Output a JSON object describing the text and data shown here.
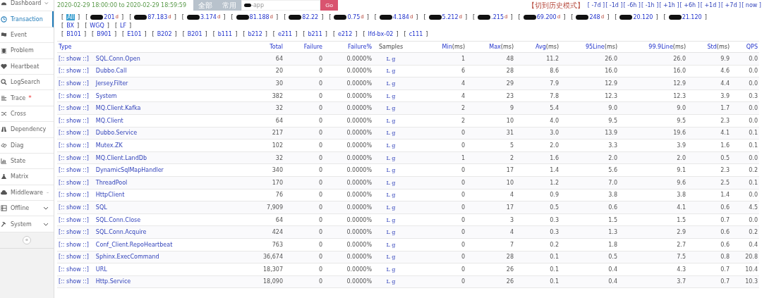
{
  "sidebar": {
    "items": [
      {
        "label": "Dashboard",
        "expandable": true,
        "selected": false
      },
      {
        "label": "Transaction",
        "expandable": false,
        "selected": true
      },
      {
        "label": "Event",
        "expandable": false,
        "selected": false
      },
      {
        "label": "Problem",
        "expandable": false,
        "selected": false
      },
      {
        "label": "Heartbeat",
        "expandable": false,
        "selected": false
      },
      {
        "label": "LogSearch",
        "expandable": false,
        "selected": false
      },
      {
        "label": "Trace",
        "expandable": false,
        "selected": false,
        "badge": "*"
      },
      {
        "label": "Cross",
        "expandable": false,
        "selected": false
      },
      {
        "label": "Dependency",
        "expandable": false,
        "selected": false
      },
      {
        "label": "Diag",
        "expandable": false,
        "selected": false
      },
      {
        "label": "State",
        "expandable": false,
        "selected": false
      },
      {
        "label": "Matrix",
        "expandable": false,
        "selected": false
      },
      {
        "label": "Middleware",
        "expandable": true,
        "selected": false
      },
      {
        "label": "Offline",
        "expandable": true,
        "selected": false
      },
      {
        "label": "System",
        "expandable": true,
        "selected": false
      }
    ],
    "collapse": "«"
  },
  "toolbar": {
    "range": "2020-02-29 18:00:00 to 2020-02-29 18:59:59",
    "buttons": [
      "全部",
      "常用"
    ],
    "domain": "-app",
    "go": "Go",
    "history": "【切到历史模式】",
    "steps": [
      "[ -7d ]",
      "[ -1d ]",
      "[ -6h ]",
      "[ -1h ]",
      "[ +1h ]",
      "[ +6h ]",
      "[ +1d ]",
      "[ +7d ]",
      "[ now ]"
    ]
  },
  "ips": [
    {
      "open": "[",
      "text": "All",
      "close": "]",
      "selected": true
    },
    {
      "open": "[",
      "text": "201",
      "flag": "d",
      "close": "]",
      "redacted": true,
      "selected": false
    },
    {
      "open": "[",
      "text": "87.183",
      "flag": "d",
      "close": "]",
      "redacted": true,
      "selected": false
    },
    {
      "open": "[",
      "text": "3.174",
      "flag": "d",
      "close": "]",
      "redacted": true,
      "selected": false
    },
    {
      "open": "[",
      "text": "81.188",
      "flag": "d",
      "close": "]",
      "redacted": true,
      "selected": false
    },
    {
      "open": "[",
      "text": "82.22",
      "close": "]",
      "redacted": true,
      "selected": false
    },
    {
      "open": "[",
      "text": "0.75",
      "flag": "d",
      "close": "]",
      "redacted": true,
      "selected": false
    },
    {
      "open": "[",
      "text": "4.184",
      "flag": "d",
      "close": "]",
      "redacted": true,
      "selected": false
    },
    {
      "open": "[",
      "text": "5.212",
      "flag": "d",
      "close": "]",
      "redacted": true,
      "selected": false
    },
    {
      "open": "[",
      "text": ".215",
      "flag": "d",
      "close": "]",
      "redacted": true,
      "selected": false
    },
    {
      "open": "[",
      "text": "69.200",
      "flag": "d",
      "close": "]",
      "redacted": true,
      "selected": false
    },
    {
      "open": "[",
      "text": "248",
      "flag": "d",
      "close": "]",
      "redacted": true,
      "selected": false
    },
    {
      "open": "[",
      "text": "20.120",
      "close": "]",
      "redacted": true,
      "selected": false
    },
    {
      "open": "[",
      "text": "21.120",
      "close": "]",
      "redacted": true,
      "selected": false
    }
  ],
  "groups": [
    {
      "open": "[",
      "text": "BX",
      "close": "]"
    },
    {
      "open": "[",
      "text": "WGQ",
      "close": "]"
    },
    {
      "open": "[",
      "text": "LF",
      "close": "]"
    }
  ],
  "machines": [
    {
      "open": "[",
      "text": "B101",
      "close": "]"
    },
    {
      "open": "[",
      "text": "B901",
      "close": "]"
    },
    {
      "open": "[",
      "text": "E101",
      "close": "]"
    },
    {
      "open": "[",
      "text": "B202",
      "close": "]"
    },
    {
      "open": "[",
      "text": "B201",
      "close": "]"
    },
    {
      "open": "[",
      "text": "b111",
      "close": "]"
    },
    {
      "open": "[",
      "text": "b212",
      "close": "]"
    },
    {
      "open": "[",
      "text": "e211",
      "close": "]"
    },
    {
      "open": "[",
      "text": "b211",
      "close": "]"
    },
    {
      "open": "[",
      "text": "e212",
      "close": "]"
    },
    {
      "open": "[",
      "text": "lfd-bx-02",
      "close": "]"
    },
    {
      "open": "[",
      "text": "c111",
      "close": "]"
    }
  ],
  "table": {
    "columns": [
      {
        "label": "Type",
        "kind": "link"
      },
      {
        "label": "Total",
        "kind": "link"
      },
      {
        "label": "Failure",
        "kind": "link"
      },
      {
        "label": "Failure%",
        "kind": "link"
      },
      {
        "label": "Samples",
        "kind": "plain"
      },
      {
        "label": "Min",
        "unit": "(ms)",
        "kind": "link"
      },
      {
        "label": "Max",
        "unit": "(ms)",
        "kind": "link"
      },
      {
        "label": "Avg",
        "unit": "(ms)",
        "kind": "link"
      },
      {
        "label": "95Line",
        "unit": "(ms)",
        "kind": "link"
      },
      {
        "label": "99.9Line",
        "unit": "(ms)",
        "kind": "link"
      },
      {
        "label": "Std",
        "unit": "(ms)",
        "kind": "link"
      },
      {
        "label": "QPS",
        "kind": "link"
      }
    ],
    "rows": [
      {
        "show": "[:: show ::]",
        "type": "SQL.Conn.Open",
        "total": "64",
        "failure": "0",
        "failure_pct": "0.0000%",
        "samples": "L g",
        "min": "1",
        "max": "48",
        "avg": "11.2",
        "p95": "26.0",
        "p999": "26.0",
        "std": "9.9",
        "qps": "0.0"
      },
      {
        "show": "[:: show ::]",
        "type": "Dubbo.Call",
        "total": "20",
        "failure": "0",
        "failure_pct": "0.0000%",
        "samples": "L g",
        "min": "6",
        "max": "28",
        "avg": "8.6",
        "p95": "16.0",
        "p999": "16.0",
        "std": "4.6",
        "qps": "0.0"
      },
      {
        "show": "[:: show ::]",
        "type": "Jersey.Filter",
        "total": "30",
        "failure": "0",
        "failure_pct": "0.0000%",
        "samples": "L g",
        "min": "4",
        "max": "29",
        "avg": "7.9",
        "p95": "12.9",
        "p999": "12.9",
        "std": "4.4",
        "qps": "0.0"
      },
      {
        "show": "[:: show ::]",
        "type": "System",
        "total": "382",
        "failure": "0",
        "failure_pct": "0.0000%",
        "samples": "L g",
        "min": "4",
        "max": "23",
        "avg": "7.8",
        "p95": "12.3",
        "p999": "12.3",
        "std": "3.9",
        "qps": "0.3"
      },
      {
        "show": "[:: show ::]",
        "type": "MQ.Client.Kafka",
        "total": "32",
        "failure": "0",
        "failure_pct": "0.0000%",
        "samples": "L g",
        "min": "2",
        "max": "9",
        "avg": "5.4",
        "p95": "9.0",
        "p999": "9.0",
        "std": "1.7",
        "qps": "0.0"
      },
      {
        "show": "[:: show ::]",
        "type": "MQ.Client",
        "total": "64",
        "failure": "0",
        "failure_pct": "0.0000%",
        "samples": "L g",
        "min": "2",
        "max": "10",
        "avg": "4.0",
        "p95": "9.5",
        "p999": "9.5",
        "std": "2.3",
        "qps": "0.0"
      },
      {
        "show": "[:: show ::]",
        "type": "Dubbo.Service",
        "total": "217",
        "failure": "0",
        "failure_pct": "0.0000%",
        "samples": "L g",
        "min": "0",
        "max": "31",
        "avg": "3.0",
        "p95": "13.9",
        "p999": "19.6",
        "std": "4.1",
        "qps": "0.1"
      },
      {
        "show": "[:: show ::]",
        "type": "Mutex.ZK",
        "total": "102",
        "failure": "0",
        "failure_pct": "0.0000%",
        "samples": "L g",
        "min": "0",
        "max": "5",
        "avg": "2.0",
        "p95": "3.3",
        "p999": "3.9",
        "std": "1.6",
        "qps": "0.1"
      },
      {
        "show": "[:: show ::]",
        "type": "MQ.Client.LandDb",
        "total": "32",
        "failure": "0",
        "failure_pct": "0.0000%",
        "samples": "L g",
        "min": "1",
        "max": "2",
        "avg": "1.6",
        "p95": "2.0",
        "p999": "2.0",
        "std": "0.5",
        "qps": "0.0"
      },
      {
        "show": "[:: show ::]",
        "type": "DynamicSqlMapHandler",
        "total": "340",
        "failure": "0",
        "failure_pct": "0.0000%",
        "samples": "L g",
        "min": "0",
        "max": "17",
        "avg": "1.4",
        "p95": "5.6",
        "p999": "9.1",
        "std": "2.3",
        "qps": "0.2"
      },
      {
        "show": "[:: show ::]",
        "type": "ThreadPool",
        "total": "170",
        "failure": "0",
        "failure_pct": "0.0000%",
        "samples": "L g",
        "min": "0",
        "max": "10",
        "avg": "1.2",
        "p95": "7.0",
        "p999": "9.6",
        "std": "2.5",
        "qps": "0.1"
      },
      {
        "show": "[:: show ::]",
        "type": "HttpClient",
        "total": "76",
        "failure": "0",
        "failure_pct": "0.0000%",
        "samples": "L g",
        "min": "0",
        "max": "4",
        "avg": "0.9",
        "p95": "3.8",
        "p999": "3.8",
        "std": "1.4",
        "qps": "0.0"
      },
      {
        "show": "[:: show ::]",
        "type": "SQL",
        "total": "7,909",
        "failure": "0",
        "failure_pct": "0.0000%",
        "samples": "L g",
        "min": "0",
        "max": "17",
        "avg": "0.5",
        "p95": "0.6",
        "p999": "4.1",
        "std": "0.6",
        "qps": "4.5"
      },
      {
        "show": "[:: show ::]",
        "type": "SQL.Conn.Close",
        "total": "64",
        "failure": "0",
        "failure_pct": "0.0000%",
        "samples": "L g",
        "min": "0",
        "max": "3",
        "avg": "0.3",
        "p95": "1.5",
        "p999": "1.5",
        "std": "0.7",
        "qps": "0.0"
      },
      {
        "show": "[:: show ::]",
        "type": "SQL.Conn.Acquire",
        "total": "424",
        "failure": "0",
        "failure_pct": "0.0000%",
        "samples": "L g",
        "min": "0",
        "max": "4",
        "avg": "0.3",
        "p95": "1.3",
        "p999": "2.9",
        "std": "0.6",
        "qps": "0.2"
      },
      {
        "show": "[:: show ::]",
        "type": "Conf_Client.RepoHeartbeat",
        "total": "763",
        "failure": "0",
        "failure_pct": "0.0000%",
        "samples": "L g",
        "min": "0",
        "max": "7",
        "avg": "0.2",
        "p95": "1.8",
        "p999": "2.7",
        "std": "0.6",
        "qps": "0.4"
      },
      {
        "show": "[:: show ::]",
        "type": "Sphinx.ExecCommand",
        "total": "36,674",
        "failure": "0",
        "failure_pct": "0.0000%",
        "samples": "L g",
        "min": "0",
        "max": "28",
        "avg": "0.1",
        "p95": "0.5",
        "p999": "7.5",
        "std": "0.8",
        "qps": "20.8"
      },
      {
        "show": "[:: show ::]",
        "type": "URL",
        "total": "18,307",
        "failure": "0",
        "failure_pct": "0.0000%",
        "samples": "L g",
        "min": "0",
        "max": "26",
        "avg": "0.1",
        "p95": "0.4",
        "p999": "4.3",
        "std": "0.7",
        "qps": "10.4"
      },
      {
        "show": "[:: show ::]",
        "type": "Http.Service",
        "total": "18,090",
        "failure": "0",
        "failure_pct": "0.0000%",
        "samples": "L g",
        "min": "0",
        "max": "26",
        "avg": "0.1",
        "p95": "0.4",
        "p999": "3.7",
        "std": "0.7",
        "qps": "10.3"
      }
    ]
  }
}
